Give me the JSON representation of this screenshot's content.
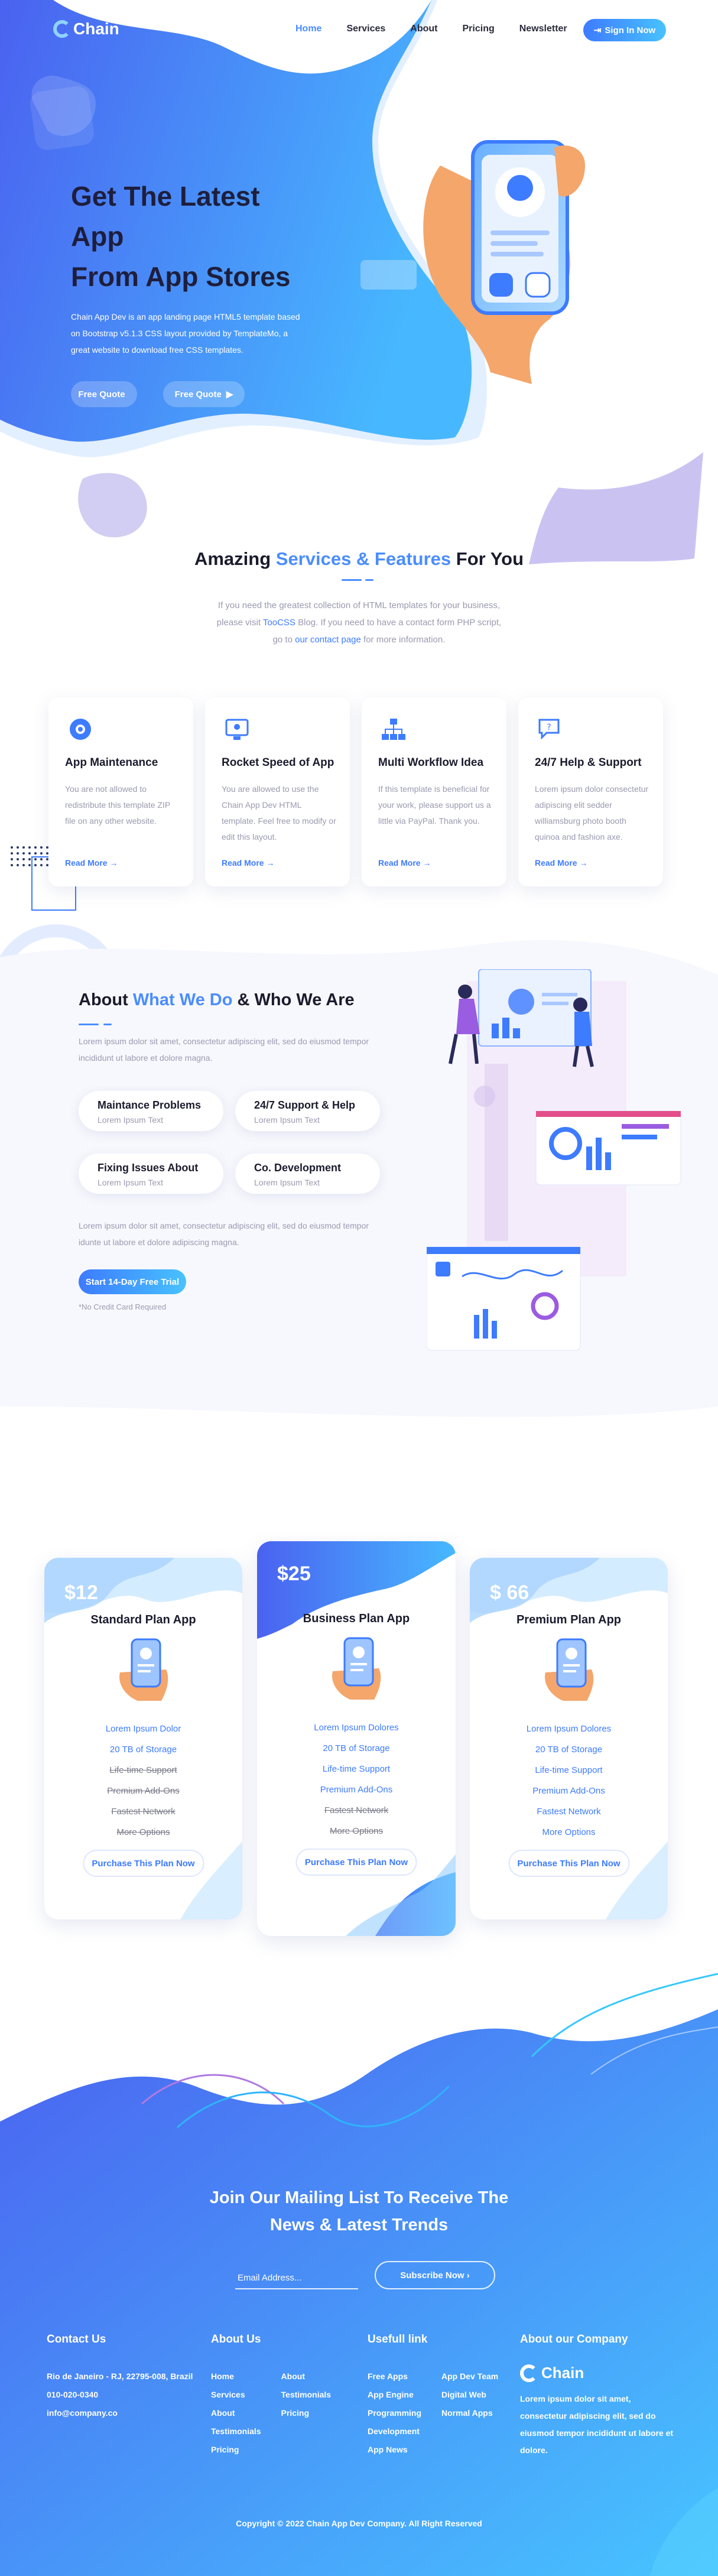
{
  "brand": {
    "name": "Chain",
    "accent": "#4b8dff",
    "gradient_start": "#3d7bff",
    "gradient_end": "#48c2ff"
  },
  "nav": {
    "items": [
      "Home",
      "Services",
      "About",
      "Pricing",
      "Newsletter"
    ],
    "active": "Home",
    "signin_label": "Sign In Now",
    "signin_icon": "login-icon"
  },
  "hero": {
    "title_line1": "Get The Latest",
    "title_line2": "App",
    "title_line3": "From App Stores",
    "description": "Chain App Dev is an app landing page HTML5 template based on Bootstrap v5.1.3 CSS layout provided by TemplateMo, a great website to download free CSS templates.",
    "buttons": [
      {
        "label": "Free Quote",
        "icon": "apple-icon"
      },
      {
        "label": "Free Quote",
        "icon": "play-icon"
      }
    ]
  },
  "services": {
    "title_pre": "Amazing ",
    "title_hl": "Services & Features",
    "title_post": " For You",
    "desc_pre": "If you need the greatest collection of HTML templates for your business, please visit ",
    "desc_link1": "TooCSS",
    "desc_mid": " Blog. If you need to have a contact form PHP script, go to ",
    "desc_link2": "our contact page",
    "desc_post": " for more information.",
    "cards": [
      {
        "title": "App Maintenance",
        "text": "You are not allowed to redistribute this template ZIP file on any other website.",
        "more": "Read More",
        "icon": "gear-icon"
      },
      {
        "title": "Rocket Speed of App",
        "text": "You are allowed to use the Chain App Dev HTML template. Feel free to modify or edit this layout.",
        "more": "Read More",
        "icon": "monitor-icon"
      },
      {
        "title": "Multi Workflow Idea",
        "text": "If this template is beneficial for your work, please support us a little via PayPal. Thank you.",
        "more": "Read More",
        "icon": "workflow-icon"
      },
      {
        "title": "24/7 Help & Support",
        "text": "Lorem ipsum dolor consectetur adipiscing elit sedder williamsburg photo booth quinoa and fashion axe.",
        "more": "Read More",
        "icon": "chat-icon"
      }
    ]
  },
  "about": {
    "title_pre": "About ",
    "title_hl": "What We Do",
    "title_post": " & Who We Are",
    "intro": "Lorem ipsum dolor sit amet, consectetur adipiscing elit, sed do eiusmod tempor incididunt ut labore et dolore magna.",
    "features": [
      {
        "title": "Maintance Problems",
        "sub": "Lorem Ipsum Text"
      },
      {
        "title": "24/7 Support & Help",
        "sub": "Lorem Ipsum Text"
      },
      {
        "title": "Fixing Issues About",
        "sub": "Lorem Ipsum Text"
      },
      {
        "title": "Co. Development",
        "sub": "Lorem Ipsum Text"
      }
    ],
    "outro": "Lorem ipsum dolor sit amet, consectetur adipiscing elit, sed do eiusmod tempor idunte ut labore et dolore adipiscing magna.",
    "cta": "Start 14-Day Free Trial",
    "note": "*No Credit Card Required"
  },
  "pricing": {
    "plans": [
      {
        "price": "$12",
        "name": "Standard Plan App",
        "features": [
          {
            "text": "Lorem Ipsum Dolor",
            "off": false
          },
          {
            "text": "20 TB of Storage",
            "off": false
          },
          {
            "text": "Life-time Support",
            "off": true
          },
          {
            "text": "Premium Add-Ons",
            "off": true
          },
          {
            "text": "Fastest Network",
            "off": true
          },
          {
            "text": "More Options",
            "off": true
          }
        ],
        "cta": "Purchase This Plan Now"
      },
      {
        "price": "$25",
        "name": "Business Plan App",
        "features": [
          {
            "text": "Lorem Ipsum Dolores",
            "off": false
          },
          {
            "text": "20 TB of Storage",
            "off": false
          },
          {
            "text": "Life-time Support",
            "off": false
          },
          {
            "text": "Premium Add-Ons",
            "off": false
          },
          {
            "text": "Fastest Network",
            "off": true
          },
          {
            "text": "More Options",
            "off": true
          }
        ],
        "cta": "Purchase This Plan Now"
      },
      {
        "price": "$ 66",
        "name": "Premium Plan App",
        "features": [
          {
            "text": "Lorem Ipsum Dolores",
            "off": false
          },
          {
            "text": "20 TB of Storage",
            "off": false
          },
          {
            "text": "Life-time Support",
            "off": false
          },
          {
            "text": "Premium Add-Ons",
            "off": false
          },
          {
            "text": "Fastest Network",
            "off": false
          },
          {
            "text": "More Options",
            "off": false
          }
        ],
        "cta": "Purchase This Plan Now"
      }
    ]
  },
  "newsletter": {
    "title_line1": "Join Our Mailing List To Receive The",
    "title_line2": "News & Latest Trends",
    "email_placeholder": "Email Address...",
    "subscribe_label": "Subscribe Now"
  },
  "footer": {
    "contact": {
      "heading": "Contact Us",
      "address": "Rio de Janeiro - RJ, 22795-008, Brazil",
      "phone": "010-020-0340",
      "email": "info@company.co"
    },
    "about": {
      "heading": "About Us",
      "col1": [
        "Home",
        "Services",
        "About",
        "Testimonials",
        "Pricing"
      ],
      "col2": [
        "About",
        "Testimonials",
        "Pricing"
      ]
    },
    "useful": {
      "heading": "Usefull link",
      "col1": [
        "Free Apps",
        "App Engine",
        "Programming",
        "Development",
        "App News"
      ],
      "col2": [
        "App Dev Team",
        "Digital Web",
        "Normal Apps"
      ]
    },
    "company": {
      "heading": "About our Company",
      "logo": "Chain",
      "text": "Lorem ipsum dolor sit amet, consectetur adipiscing elit, sed do eiusmod tempor incididunt ut labore et dolore."
    },
    "copyright": "Copyright © 2022 Chain App Dev Company. All Right Reserved"
  }
}
